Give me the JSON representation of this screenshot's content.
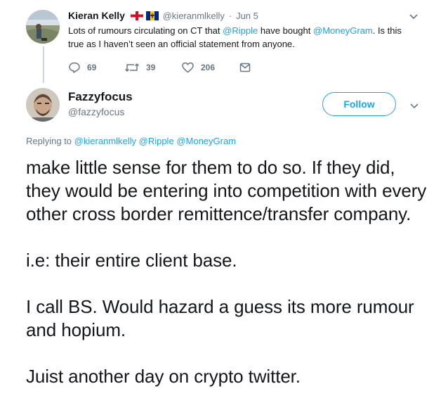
{
  "parent_tweet": {
    "author_name": "Kieran Kelly",
    "author_flags": [
      "england-flag-icon",
      "barbados-flag-icon"
    ],
    "handle": "@kieranmlkelly",
    "separator": "·",
    "date": "Jun 5",
    "text_parts": [
      {
        "type": "text",
        "value": "Lots of rumours circulating on CT that "
      },
      {
        "type": "mention",
        "value": "@Ripple"
      },
      {
        "type": "text",
        "value": " have bought "
      },
      {
        "type": "mention",
        "value": "@MoneyGram"
      },
      {
        "type": "text",
        "value": ". Is this true as I haven’t seen an official statement from anyone."
      }
    ],
    "actions": {
      "replies": "69",
      "retweets": "39",
      "likes": "206"
    }
  },
  "reply_tweet": {
    "author_name": "Fazzyfocus",
    "handle": "@fazzyfocus",
    "follow_label": "Follow",
    "replying_prefix": "Replying to",
    "replying_mentions": [
      "@kieranmlkelly",
      "@Ripple",
      "@MoneyGram"
    ],
    "paragraphs": [
      "make little sense for them to do so. If they did, they would be entering into competition with every other cross border remittence/transfer company.",
      "i.e: their entire client base.",
      "I call BS. Would hazard a guess its more rumour and hopium.",
      "Juist another day on crypto twitter."
    ]
  },
  "colors": {
    "accent": "#1da1f2",
    "text": "#14171a",
    "muted": "#657786",
    "thread_line": "#ccd6dd"
  },
  "icons": [
    "reply-icon",
    "retweet-icon",
    "like-icon",
    "direct-message-icon",
    "chevron-down-icon"
  ]
}
